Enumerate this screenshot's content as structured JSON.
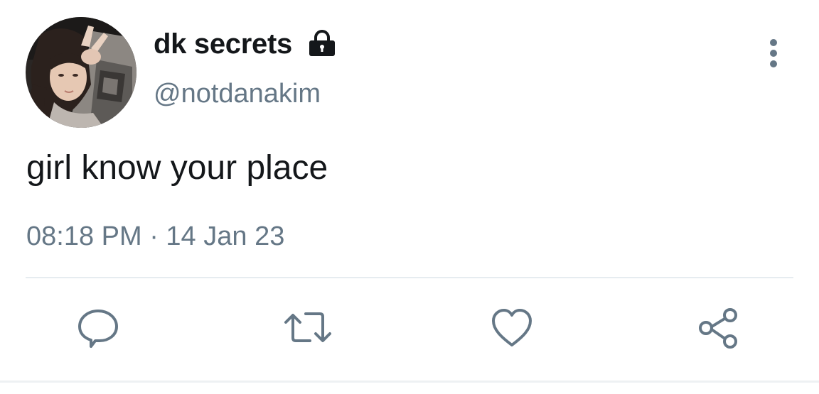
{
  "tweet": {
    "display_name": "dk secrets",
    "handle": "@notdanakim",
    "text": "girl know your place",
    "timestamp": "08:18 PM · 14 Jan 23",
    "protected_icon": "lock-icon",
    "avatar": "profile-photo-avatar"
  },
  "actions": {
    "reply_icon": "reply-icon",
    "retweet_icon": "retweet-icon",
    "like_icon": "heart-icon",
    "share_icon": "share-icon",
    "more_icon": "more-vertical-icon"
  },
  "colors": {
    "text_primary": "#14171a",
    "text_secondary": "#657786",
    "divider": "#e6ecf0",
    "background": "#ffffff"
  }
}
